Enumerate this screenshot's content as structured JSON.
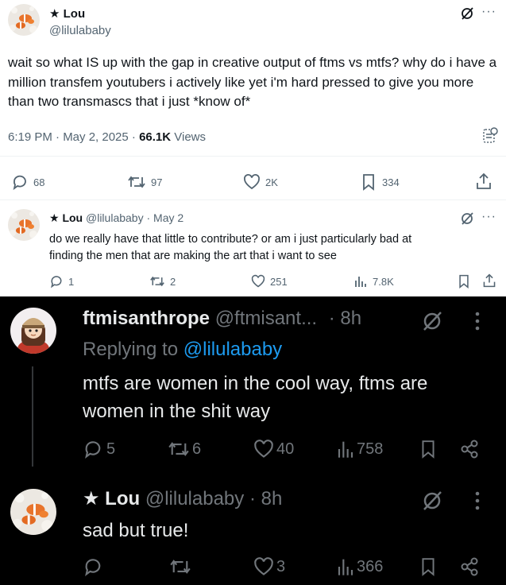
{
  "main_tweet": {
    "name": "★ Lou",
    "handle": "@lilulababy",
    "text": "wait so what IS up with the gap in creative output of ftms vs mtfs? why do i have a million transfem youtubers i actively like yet i'm hard pressed to give you more than two transmascs that i just *know of*",
    "time": "6:19 PM · May 2, 2025 · ",
    "views_count": "66.1K",
    "views_label": " Views",
    "replies": "68",
    "reposts": "97",
    "likes": "2K",
    "bookmarks": "334"
  },
  "thread_reply": {
    "name": "★ Lou",
    "handle": "@lilulababy",
    "date": "· May 2",
    "text_line1": "do we really have that little to contribute? or am i just particularly bad at",
    "text_line2": "finding the men that are making the art that i want to see",
    "replies": "1",
    "reposts": "2",
    "likes": "251",
    "views": "7.8K"
  },
  "dark_reply_1": {
    "name": "ftmisanthrope",
    "handle": "@ftmisant...",
    "time": "· 8h",
    "replying_prefix": "Replying to ",
    "replying_to": "@lilulababy",
    "text_line1": "mtfs are women in the cool way, ftms are",
    "text_line2": "women in the shit way",
    "replies": "5",
    "reposts": "6",
    "likes": "40",
    "views": "758"
  },
  "dark_reply_2": {
    "name": "★ Lou",
    "handle": "@lilulababy",
    "time": "· 8h",
    "text": "sad but true!",
    "replies": "",
    "reposts": "",
    "likes": "3",
    "views": "366"
  },
  "colors": {
    "link_blue": "#1d9bf0",
    "light_text": "#0f1419",
    "light_muted": "#536471",
    "dark_text": "#e7e9ea",
    "dark_muted": "#71767b"
  }
}
